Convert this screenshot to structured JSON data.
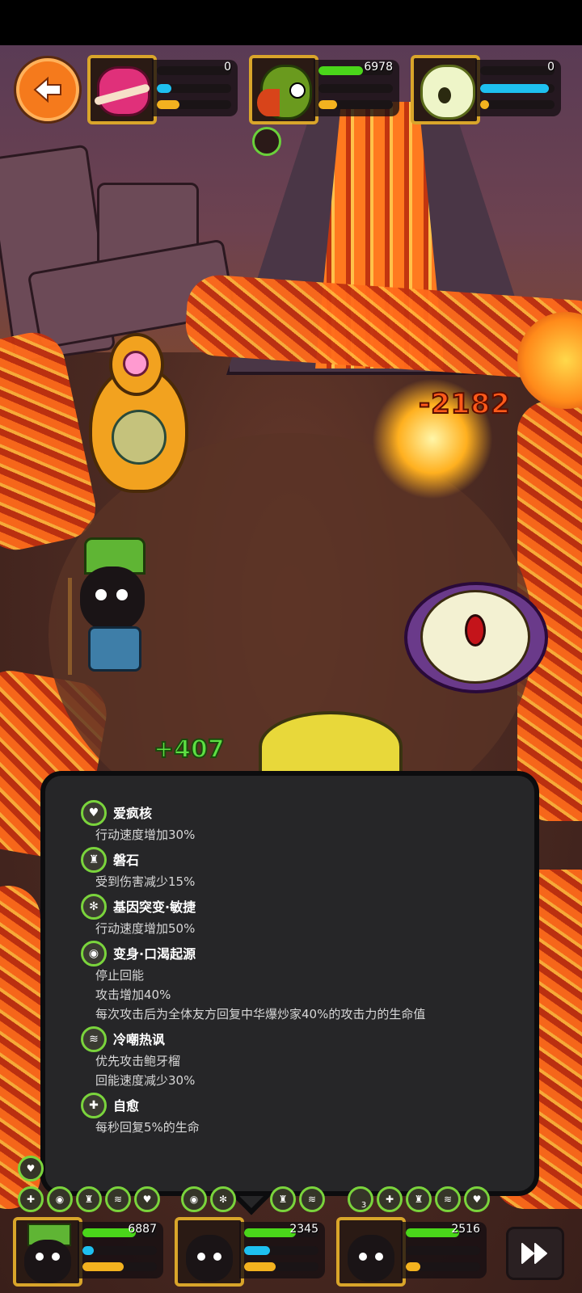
{
  "enemies": [
    {
      "name": "pink-tentacle-monster",
      "hp_value": "0",
      "hp_fill": 0.0,
      "mp_fill": 0.2,
      "xp_fill": 0.3
    },
    {
      "name": "green-rooster-monster",
      "hp_value": "6978",
      "hp_fill": 0.6,
      "mp_fill": 0.0,
      "xp_fill": 0.25
    },
    {
      "name": "apple-monster",
      "hp_value": "0",
      "hp_fill": 0.0,
      "mp_fill": 0.92,
      "xp_fill": 0.12
    }
  ],
  "battle": {
    "damage_text": "-2182",
    "heal_text": "+407"
  },
  "tooltip": {
    "buffs": [
      {
        "name": "爱疯核",
        "lines": [
          "行动速度增加30%"
        ]
      },
      {
        "name": "磐石",
        "lines": [
          "受到伤害减少15%"
        ]
      },
      {
        "name": "基因突变·敏捷",
        "lines": [
          "行动速度增加50%"
        ]
      },
      {
        "name": "变身·口渴起源",
        "lines": [
          "停止回能",
          "攻击增加40%",
          "每次攻击后为全体友方回复中华爆炒家40%的攻击力的生命值"
        ]
      },
      {
        "name": "冷嘲热讽",
        "lines": [
          "优先攻击鲍牙榴",
          "回能速度减少30%"
        ]
      },
      {
        "name": "自愈",
        "lines": [
          "每秒回复5%的生命"
        ]
      }
    ]
  },
  "heroes": [
    {
      "name": "crowned-hero",
      "hp_value": "6887",
      "hp_fill": 0.72,
      "mp_fill": 0.15,
      "xp_fill": 0.55
    },
    {
      "name": "dark-hero-2",
      "hp_value": "2345",
      "hp_fill": 0.7,
      "mp_fill": 0.35,
      "xp_fill": 0.42
    },
    {
      "name": "dark-hero-3",
      "hp_value": "2516",
      "hp_fill": 0.72,
      "mp_fill": 0.0,
      "xp_fill": 0.2
    }
  ],
  "icon_row": {
    "badge_3": "3"
  },
  "colors": {
    "hp": "#4ad61a",
    "mp": "#1ec0f0",
    "xp": "#f3b21f",
    "frame": "#d9a52a",
    "buff_ring": "#7ad43c"
  }
}
